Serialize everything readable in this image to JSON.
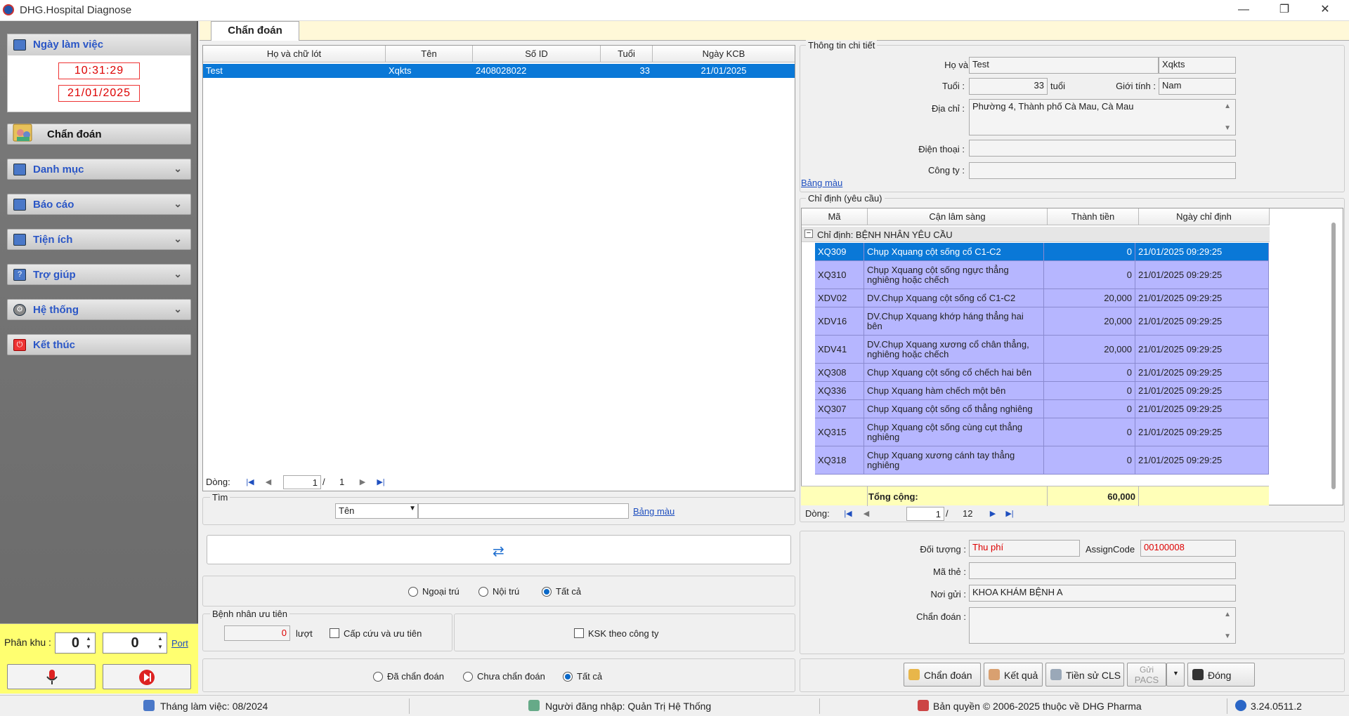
{
  "window": {
    "title": "DHG.Hospital Diagnose",
    "minimize": "—",
    "restore": "❐",
    "close": "✕"
  },
  "sidebar": {
    "work_day_header": "Ngày làm việc",
    "time": "10:31:29",
    "date": "21/01/2025",
    "items": [
      {
        "label": "Chẩn đoán",
        "active": true
      },
      {
        "label": "Danh mục"
      },
      {
        "label": "Báo cáo"
      },
      {
        "label": "Tiện ích"
      },
      {
        "label": "Trợ giúp"
      },
      {
        "label": "Hệ thống"
      },
      {
        "label": "Kết thúc"
      }
    ],
    "zone_label": "Phân khu :",
    "zone_value": "0",
    "port_value": "0",
    "port_link": "Port"
  },
  "tabs": [
    {
      "label": "Chẩn đoán"
    }
  ],
  "patient_grid": {
    "columns": [
      "Họ và chữ lót",
      "Tên",
      "Số ID",
      "Tuổi",
      "Ngày KCB"
    ],
    "rows": [
      [
        "Test",
        "Xqkts",
        "2408028022",
        "33",
        "21/01/2025"
      ]
    ],
    "pager": {
      "label": "Dòng:",
      "page": "1",
      "sep": "/",
      "total": "1"
    }
  },
  "search": {
    "legend": "Tìm",
    "field": "Tên",
    "link": "Bảng màu"
  },
  "filters": {
    "visit_type": [
      {
        "label": "Ngoại trú",
        "checked": false
      },
      {
        "label": "Nội trú",
        "checked": false
      },
      {
        "label": "Tất cả",
        "checked": true
      }
    ],
    "priority_legend": "Bệnh nhân ưu tiên",
    "priority_count": "0",
    "priority_unit": "lượt",
    "emergency_label": "Cấp cứu và ưu tiên",
    "ksk_label": "KSK theo công ty",
    "diag_status": [
      {
        "label": "Đã chẩn đoán",
        "checked": false
      },
      {
        "label": "Chưa chẩn đoán",
        "checked": false
      },
      {
        "label": "Tất cả",
        "checked": true
      }
    ]
  },
  "detail": {
    "legend": "Thông tin chi tiết",
    "name_label": "Họ và tên :",
    "last_name": "Test",
    "first_name": "Xqkts",
    "age_label": "Tuổi :",
    "age": "33",
    "age_unit": "tuổi",
    "gender_label": "Giới tính :",
    "gender": "Nam",
    "address_label": "Địa chỉ :",
    "address": "Phường 4, Thành phố Cà Mau, Cà Mau",
    "phone_label": "Điện thoại :",
    "phone": "",
    "company_label": "Công ty :",
    "company": "",
    "color_link": "Bảng màu"
  },
  "orders": {
    "legend": "Chỉ định (yêu cầu)",
    "columns": [
      "Mã",
      "Cận lâm sàng",
      "Thành tiền",
      "Ngày chỉ định"
    ],
    "group_label": "Chỉ định:  BỆNH NHÂN YÊU CẦU",
    "rows": [
      {
        "code": "XQ309",
        "name": "Chụp Xquang cột sống cổ C1-C2",
        "price": "0",
        "date": "21/01/2025 09:29:25"
      },
      {
        "code": "XQ310",
        "name": "Chụp Xquang cột sống ngực thẳng nghiêng hoặc chếch",
        "price": "0",
        "date": "21/01/2025 09:29:25"
      },
      {
        "code": "XDV02",
        "name": "DV.Chụp Xquang cột sống cổ C1-C2",
        "price": "20,000",
        "date": "21/01/2025 09:29:25"
      },
      {
        "code": "XDV16",
        "name": "DV.Chụp Xquang khớp háng thẳng hai bên",
        "price": "20,000",
        "date": "21/01/2025 09:29:25"
      },
      {
        "code": "XDV41",
        "name": "DV.Chụp Xquang xương cổ chân thẳng, nghiêng hoặc chếch",
        "price": "20,000",
        "date": "21/01/2025 09:29:25"
      },
      {
        "code": "XQ308",
        "name": "Chụp Xquang cột sống cổ chếch hai bên",
        "price": "0",
        "date": "21/01/2025 09:29:25"
      },
      {
        "code": "XQ336",
        "name": "Chụp Xquang hàm chếch một bên",
        "price": "0",
        "date": "21/01/2025 09:29:25"
      },
      {
        "code": "XQ307",
        "name": "Chụp Xquang cột sống cổ thẳng nghiêng",
        "price": "0",
        "date": "21/01/2025 09:29:25"
      },
      {
        "code": "XQ315",
        "name": "Chụp Xquang cột sống cùng cụt thẳng nghiêng",
        "price": "0",
        "date": "21/01/2025 09:29:25"
      },
      {
        "code": "XQ318",
        "name": "Chụp Xquang xương cánh tay thẳng nghiêng",
        "price": "0",
        "date": "21/01/2025 09:29:25"
      }
    ],
    "total_label": "Tổng cộng:",
    "total": "60,000",
    "pager": {
      "label": "Dòng:",
      "page": "1",
      "sep": "/",
      "total": "12"
    }
  },
  "bottom_detail": {
    "object_label": "Đối tượng :",
    "object": "Thu phí",
    "assign_label": "AssignCode",
    "assign": "00100008",
    "card_label": "Mã thẻ :",
    "card": "",
    "sender_label": "Nơi gửi :",
    "sender": "KHOA KHÁM BỆNH A",
    "diag_label": "Chẩn đoán :",
    "diag": ""
  },
  "actions": {
    "diagnose": "Chẩn đoán",
    "result": "Kết quả",
    "history": "Tiền sử CLS",
    "pacs1": "Gửi",
    "pacs2": "PACS",
    "close": "Đóng"
  },
  "status": {
    "month": "Tháng làm việc: 08/2024",
    "user": "Người đăng nhập: Quản Trị Hệ Thống",
    "copyright": "Bản quyền © 2006-2025 thuộc về DHG Pharma",
    "version": "3.24.0511.2"
  }
}
